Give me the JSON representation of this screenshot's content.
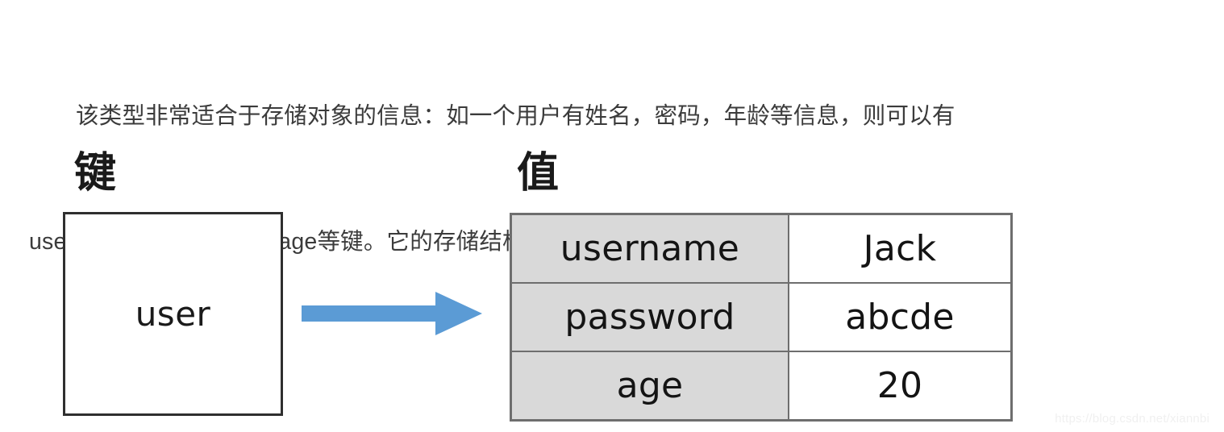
{
  "page": {
    "body_text": {
      "line1_indent": "　　",
      "line1": "该类型非常适合于存储对象的信息：如一个用户有姓名，密码，年龄等信息，则可以有",
      "line2": "username、password和age等键。它的存储结构如下："
    },
    "watermark": "https://blog.csdn.net/xiannbi"
  },
  "diagram": {
    "key_column": {
      "heading": "键",
      "box_value": "user"
    },
    "arrow": {
      "name": "right-arrow",
      "color": "#5b9bd5",
      "direction": "right"
    },
    "value_column": {
      "heading": "值",
      "rows": [
        {
          "key": "username",
          "value": "Jack"
        },
        {
          "key": "password",
          "value": "abcde"
        },
        {
          "key": "age",
          "value": "20"
        }
      ]
    },
    "colors": {
      "key_cell_background": "#d9d9d9",
      "value_cell_background": "#ffffff",
      "border": "#6e6e6e",
      "box_border": "#2f2f2f",
      "text": "#141414",
      "arrow": "#5b9bd5"
    }
  }
}
